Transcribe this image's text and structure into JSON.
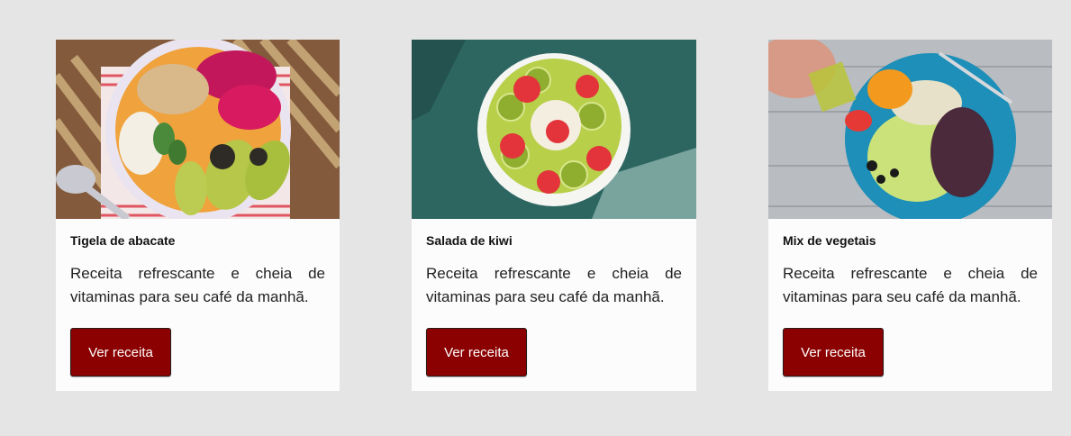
{
  "cards": [
    {
      "title": "Tigela de abacate",
      "description": "Receita refrescante e cheia de vitaminas para seu café da manhã.",
      "button_label": "Ver receita",
      "image": "avocado-bowl-photo"
    },
    {
      "title": "Salada de kiwi",
      "description": "Receita refrescante e cheia de vitaminas para seu café da manhã.",
      "button_label": "Ver receita",
      "image": "kiwi-salad-photo"
    },
    {
      "title": "Mix de vegetais",
      "description": "Receita refrescante e cheia de vitaminas para seu café da manhã.",
      "button_label": "Ver receita",
      "image": "vegetable-mix-photo"
    }
  ],
  "colors": {
    "background": "#e5e5e5",
    "card": "#fcfcfc",
    "button": "#8b0000",
    "button_text": "#ffffff"
  }
}
